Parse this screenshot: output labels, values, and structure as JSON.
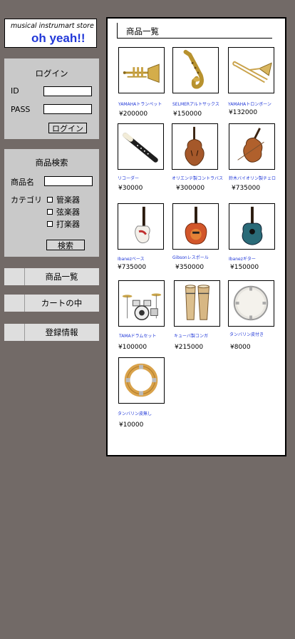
{
  "logo": {
    "tagline": "musical  instrumart store",
    "title": "oh yeah!!"
  },
  "login": {
    "title": "ログイン",
    "id_label": "ID",
    "pass_label": "PASS",
    "id_value": "",
    "pass_value": "",
    "button": "ログイン"
  },
  "search": {
    "title": "商品検索",
    "name_label": "商品名",
    "name_value": "",
    "category_label": "カテゴリ",
    "categories": [
      "管楽器",
      "弦楽器",
      "打楽器"
    ],
    "button": "検索"
  },
  "nav": [
    "商品一覧",
    "カートの中",
    "登録情報"
  ],
  "main": {
    "title": "商品一覧"
  },
  "products": [
    {
      "name": "YAMAHAトランペット",
      "price": "¥200000",
      "icon": "trumpet-icon"
    },
    {
      "name": "SELMERアルトサックス",
      "price": "¥150000",
      "icon": "saxophone-icon"
    },
    {
      "name": "YAMAHAトロンボーン",
      "price": "¥132000",
      "icon": "trombone-icon"
    },
    {
      "name": "リコーダー",
      "price": "¥30000",
      "icon": "recorder-icon"
    },
    {
      "name": "オリエンテ製コントラバス",
      "price": "¥300000",
      "icon": "contrabass-icon"
    },
    {
      "name": "鈴木バイオリン製チェロ",
      "price": "¥735000",
      "icon": "cello-icon"
    },
    {
      "name": "Ibanezベース",
      "price": "¥735000",
      "icon": "bass-guitar-icon"
    },
    {
      "name": "Gibsonレスポール",
      "price": "¥350000",
      "icon": "les-paul-icon"
    },
    {
      "name": "Ibanezギター",
      "price": "¥150000",
      "icon": "acoustic-guitar-icon"
    },
    {
      "name": "TAMAドラムセット",
      "price": "¥100000",
      "icon": "drum-set-icon"
    },
    {
      "name": "キューバ製コンガ",
      "price": "¥215000",
      "icon": "conga-icon"
    },
    {
      "name": "タンバリン皮付き",
      "price": "¥8000",
      "icon": "tambourine-icon"
    },
    {
      "name": "タンバリン皮無し",
      "price": "¥10000",
      "icon": "tambourine-ring-icon"
    }
  ]
}
